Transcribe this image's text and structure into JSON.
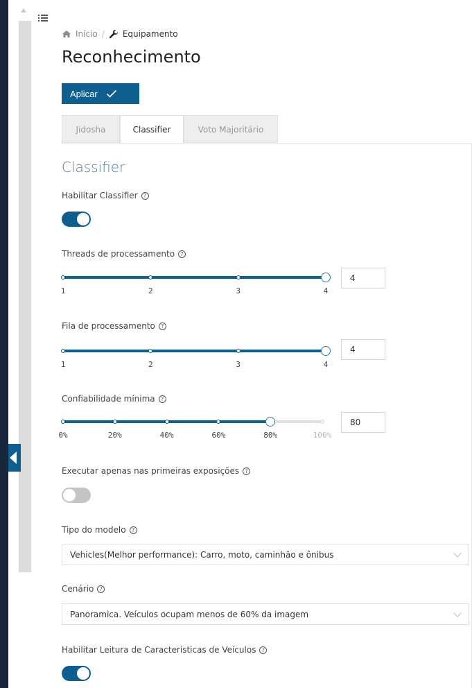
{
  "breadcrumb": {
    "home": "Início",
    "separator": "/",
    "current": "Equipamento"
  },
  "page_title": "Reconhecimento",
  "apply_button": "Aplicar",
  "tabs": [
    {
      "label": "Jidosha",
      "active": false
    },
    {
      "label": "Classifier",
      "active": true
    },
    {
      "label": "Voto Majoritário",
      "active": false
    }
  ],
  "section_title": "Classifier",
  "help_glyph": "?",
  "fields": {
    "enable_classifier": {
      "label": "Habilitar Classifier",
      "on": true
    },
    "threads": {
      "label": "Threads de processamento",
      "ticks": [
        "1",
        "2",
        "3",
        "4"
      ],
      "value": "4",
      "fraction": 1.0
    },
    "queue": {
      "label": "Fila de processamento",
      "ticks": [
        "1",
        "2",
        "3",
        "4"
      ],
      "value": "4",
      "fraction": 1.0
    },
    "confidence": {
      "label": "Confiabilidade mínima",
      "ticks": [
        "0%",
        "20%",
        "40%",
        "60%",
        "80%",
        "100%"
      ],
      "value": "80",
      "fraction": 0.8
    },
    "first_exposures": {
      "label": "Executar apenas nas primeiras exposições",
      "on": false
    },
    "model_type": {
      "label": "Tipo do modelo",
      "selected": "Vehicles(Melhor performance): Carro, moto, caminhão e ônibus"
    },
    "scenario": {
      "label": "Cenário",
      "selected": "Panoramica. Veículos ocupam menos de 60% da imagem"
    },
    "vehicle_features": {
      "label": "Habilitar Leitura de Características de Veículos",
      "on": true
    }
  },
  "colors": {
    "primary": "#0e5f8f",
    "section_title": "#4a7fad",
    "sidebar": "#17263a"
  }
}
